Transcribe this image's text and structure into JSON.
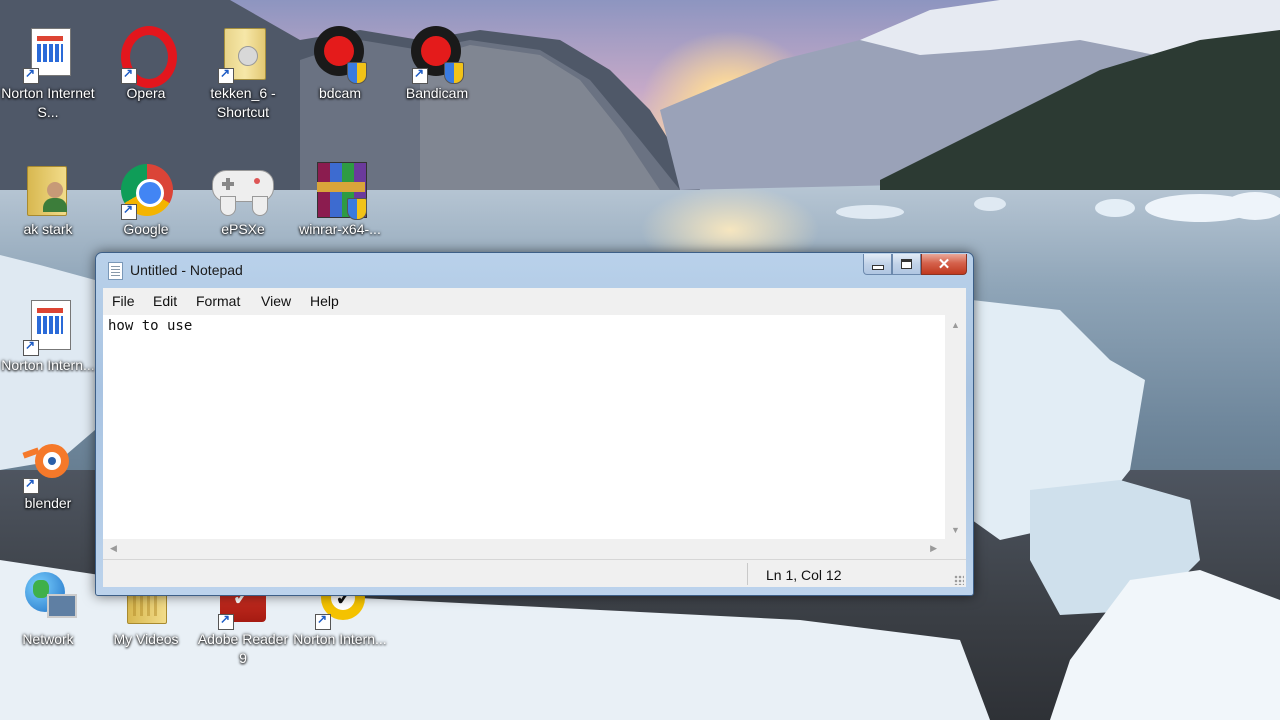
{
  "desktop": {
    "icons": [
      {
        "label": "Norton Internet S...",
        "icon": "norton-internet-security-icon"
      },
      {
        "label": "Opera",
        "icon": "opera-icon"
      },
      {
        "label": "tekken_6 - Shortcut",
        "icon": "tekken-shortcut-icon"
      },
      {
        "label": "bdcam",
        "icon": "bdcam-icon"
      },
      {
        "label": "Bandicam",
        "icon": "bandicam-icon"
      },
      {
        "label": "ak stark",
        "icon": "user-folder-icon"
      },
      {
        "label": "Google",
        "icon": "chrome-icon"
      },
      {
        "label": "ePSXe",
        "icon": "gamepad-icon"
      },
      {
        "label": "winrar-x64-...",
        "icon": "winrar-icon"
      },
      {
        "label": "Norton Intern...",
        "icon": "norton-internet-icon"
      },
      {
        "label": "blender",
        "icon": "blender-icon"
      },
      {
        "label": "Network",
        "icon": "network-icon"
      },
      {
        "label": "My Videos",
        "icon": "videos-folder-icon"
      },
      {
        "label": "Adobe Reader 9",
        "icon": "adobe-reader-icon"
      },
      {
        "label": "Norton Intern...",
        "icon": "norton-icon"
      }
    ]
  },
  "notepad": {
    "title": "Untitled - Notepad",
    "window_controls": {
      "minimize": "minimize-icon",
      "maximize": "maximize-icon",
      "close": "close-icon"
    },
    "menu": [
      "File",
      "Edit",
      "Format",
      "View",
      "Help"
    ],
    "content": "how to use",
    "status": "Ln 1, Col 12"
  }
}
